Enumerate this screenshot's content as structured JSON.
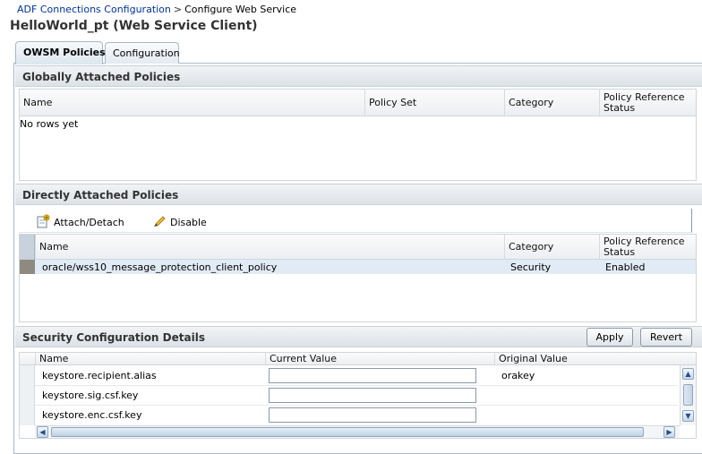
{
  "breadcrumb": {
    "link": "ADF Connections Configuration",
    "separator": ">",
    "current": "Configure Web Service"
  },
  "page_title": "HelloWorld_pt (Web Service Client)",
  "tabs": [
    {
      "label": "OWSM Policies",
      "active": true
    },
    {
      "label": "Configuration",
      "active": false
    }
  ],
  "global_policies": {
    "title": "Globally Attached Policies",
    "columns": [
      "Name",
      "Policy Set",
      "Category",
      "Policy Reference Status"
    ],
    "empty_text": "No rows yet"
  },
  "direct_policies": {
    "title": "Directly Attached Policies",
    "toolbar": {
      "attach_label": "Attach/Detach",
      "disable_label": "Disable"
    },
    "columns": [
      "Name",
      "Category",
      "Policy Reference Status"
    ],
    "rows": [
      {
        "name": "oracle/wss10_message_protection_client_policy",
        "category": "Security",
        "status": "Enabled"
      }
    ]
  },
  "security_config": {
    "title": "Security Configuration Details",
    "apply_label": "Apply",
    "revert_label": "Revert",
    "columns": [
      "Name",
      "Current Value",
      "Original Value"
    ],
    "rows": [
      {
        "name": "keystore.recipient.alias",
        "current": "",
        "original": "orakey"
      },
      {
        "name": "keystore.sig.csf.key",
        "current": "",
        "original": ""
      },
      {
        "name": "keystore.enc.csf.key",
        "current": "",
        "original": ""
      }
    ]
  },
  "icons": {
    "attach": "attach-detach-icon",
    "disable": "pencil-icon",
    "scroll_up": "chevron-up-icon",
    "scroll_down": "chevron-down-icon",
    "scroll_left": "chevron-left-icon",
    "scroll_right": "chevron-right-icon"
  },
  "colors": {
    "link": "#003399",
    "tab_border": "#a8b8c8",
    "selected_row": "#e1ebf5",
    "scrollbar": "#c9d7e6"
  }
}
